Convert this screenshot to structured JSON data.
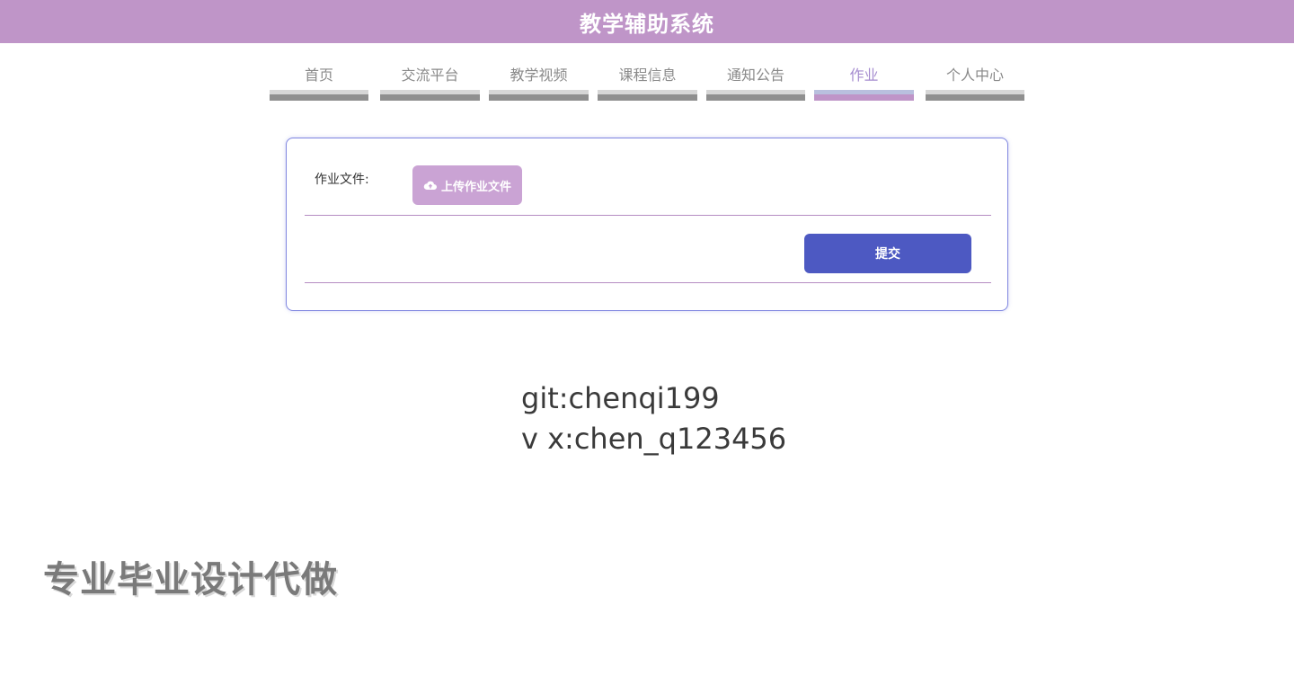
{
  "header": {
    "title": "教学辅助系统"
  },
  "nav": {
    "items": [
      {
        "label": "首页"
      },
      {
        "label": "交流平台"
      },
      {
        "label": "教学视频"
      },
      {
        "label": "课程信息"
      },
      {
        "label": "通知公告"
      },
      {
        "label": "作业",
        "active": true
      },
      {
        "label": "个人中心"
      }
    ]
  },
  "form": {
    "file_label": "作业文件:",
    "upload_label": "上传作业文件",
    "submit_label": "提交"
  },
  "overlay": {
    "git": "git:chenqi199",
    "wechat": "v x:chen_q123456",
    "promo": "专业毕业设计代做"
  },
  "colors": {
    "header_bg": "#bf95c8",
    "upload_bg": "#caa3d4",
    "submit_bg": "#4d59c2",
    "active_nav": "#a58ccf"
  }
}
